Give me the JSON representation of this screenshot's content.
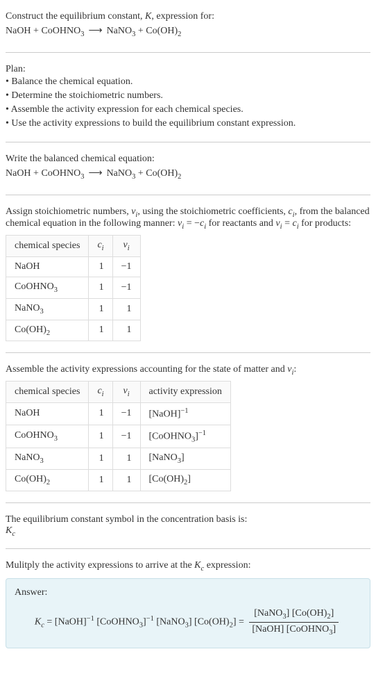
{
  "header": {
    "prompt_prefix": "Construct the equilibrium constant, ",
    "prompt_k": "K",
    "prompt_suffix": ", expression for:",
    "equation_lhs1": "NaOH",
    "equation_lhs2": "CoOHNO",
    "equation_lhs2_sub": "3",
    "arrow": "⟶",
    "equation_rhs1": "NaNO",
    "equation_rhs1_sub": "3",
    "equation_rhs2": "Co(OH)",
    "equation_rhs2_sub": "2"
  },
  "plan": {
    "title": "Plan:",
    "items": [
      "• Balance the chemical equation.",
      "• Determine the stoichiometric numbers.",
      "• Assemble the activity expression for each chemical species.",
      "• Use the activity expressions to build the equilibrium constant expression."
    ]
  },
  "balanced": {
    "intro": "Write the balanced chemical equation:"
  },
  "stoich": {
    "intro_p1": "Assign stoichiometric numbers, ",
    "intro_nu": "ν",
    "intro_i": "i",
    "intro_p2": ", using the stoichiometric coefficients, ",
    "intro_c": "c",
    "intro_p3": ", from the balanced chemical equation in the following manner: ",
    "intro_p4": " = −",
    "intro_p5": " for reactants and ",
    "intro_p6": " = ",
    "intro_p7": " for products:",
    "headers": {
      "species": "chemical species",
      "ci": "c",
      "nu": "ν"
    },
    "rows": [
      {
        "species": "NaOH",
        "sub": "",
        "ci": "1",
        "nu": "−1"
      },
      {
        "species": "CoOHNO",
        "sub": "3",
        "ci": "1",
        "nu": "−1"
      },
      {
        "species": "NaNO",
        "sub": "3",
        "ci": "1",
        "nu": "1"
      },
      {
        "species": "Co(OH)",
        "sub": "2",
        "ci": "1",
        "nu": "1"
      }
    ]
  },
  "activity": {
    "intro_p1": "Assemble the activity expressions accounting for the state of matter and ",
    "intro_nu": "ν",
    "intro_i": "i",
    "intro_colon": ":",
    "headers": {
      "species": "chemical species",
      "ci": "c",
      "nu": "ν",
      "expr": "activity expression"
    },
    "rows": [
      {
        "species": "NaOH",
        "sub": "",
        "ci": "1",
        "nu": "−1",
        "expr_base": "[NaOH]",
        "expr_sup": "−1"
      },
      {
        "species": "CoOHNO",
        "sub": "3",
        "ci": "1",
        "nu": "−1",
        "expr_base": "[CoOHNO",
        "expr_sub": "3",
        "expr_close": "]",
        "expr_sup": "−1"
      },
      {
        "species": "NaNO",
        "sub": "3",
        "ci": "1",
        "nu": "1",
        "expr_base": "[NaNO",
        "expr_sub": "3",
        "expr_close": "]",
        "expr_sup": ""
      },
      {
        "species": "Co(OH)",
        "sub": "2",
        "ci": "1",
        "nu": "1",
        "expr_base": "[Co(OH)",
        "expr_sub": "2",
        "expr_close": "]",
        "expr_sup": ""
      }
    ]
  },
  "symbol": {
    "intro": "The equilibrium constant symbol in the concentration basis is:",
    "k": "K",
    "sub": "c"
  },
  "multiply": {
    "intro_p1": "Mulitply the activity expressions to arrive at the ",
    "intro_k": "K",
    "intro_sub": "c",
    "intro_p2": " expression:"
  },
  "answer": {
    "label": "Answer:",
    "k": "K",
    "ksub": "c",
    "eq": " = ",
    "t1": "[NaOH]",
    "t1sup": "−1",
    "t2a": " [CoOHNO",
    "t2sub": "3",
    "t2b": "]",
    "t2sup": "−1",
    "t3a": " [NaNO",
    "t3sub": "3",
    "t3b": "]",
    "t4a": " [Co(OH)",
    "t4sub": "2",
    "t4b": "] = ",
    "num1a": "[NaNO",
    "num1sub": "3",
    "num1b": "] [Co(OH)",
    "num2sub": "2",
    "num2b": "]",
    "den1": "[NaOH] [CoOHNO",
    "den1sub": "3",
    "den1b": "]"
  }
}
